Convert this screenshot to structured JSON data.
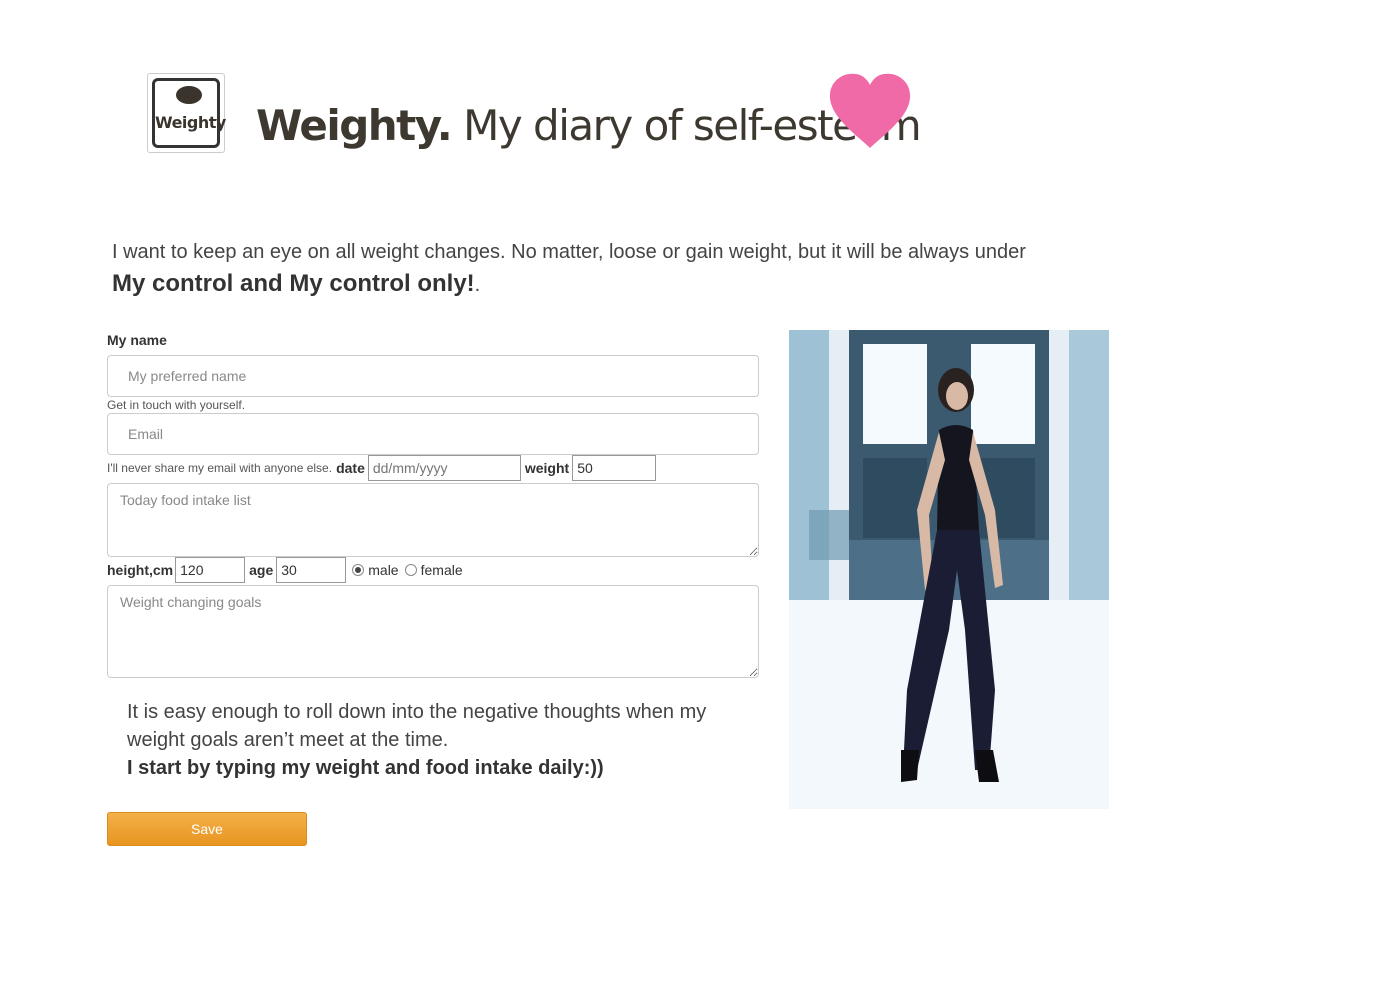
{
  "header": {
    "logo_text": "Weighty",
    "title_bold": "Weighty.",
    "title_rest": " My diary of self-esteem",
    "heart_color": "#f06aa8"
  },
  "intro": {
    "line1": "I want to keep an eye on all weight changes. No matter, loose or gain weight, but it will be always under",
    "line2_bold": "My control and My control only!",
    "line2_tail": "."
  },
  "form": {
    "name_label": "My name",
    "name_placeholder": "My preferred name",
    "name_help": "Get in touch with yourself.",
    "email_placeholder": "Email",
    "email_help": "I'll never share my email with anyone else.",
    "date_label": "date",
    "date_placeholder": "dd/mm/yyyy",
    "weight_label": "weight",
    "weight_value": "50",
    "food_placeholder": "Today food intake list",
    "height_label": "height,cm",
    "height_value": "120",
    "age_label": "age",
    "age_value": "30",
    "gender_options": [
      "male",
      "female"
    ],
    "gender_selected": "male",
    "goals_placeholder": "Weight changing goals"
  },
  "message": {
    "line1": "It is easy enough to roll down into the negative thoughts when my weight goals aren’t meet at the time.",
    "line2_bold": "I start by typing my weight and food intake daily:))"
  },
  "actions": {
    "save_label": "Save",
    "save_color": "#ef9f2c"
  }
}
